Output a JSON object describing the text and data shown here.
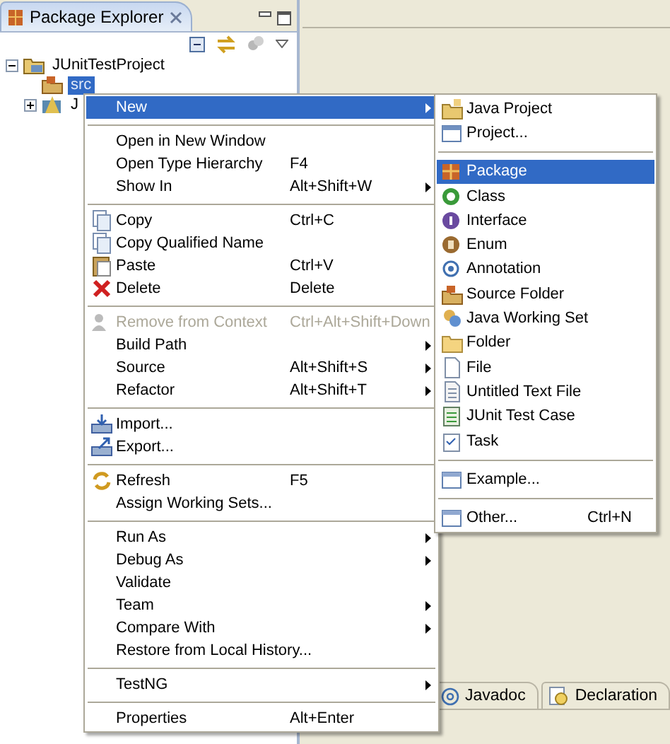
{
  "view": {
    "title": "Package Explorer"
  },
  "tree": [
    {
      "label": "JUnitTestProject",
      "expanded": true,
      "selected": false,
      "children": [
        {
          "label": "src",
          "selected": false,
          "highlighted": true
        },
        {
          "label": "J",
          "expanded": false,
          "selected": false
        }
      ]
    }
  ],
  "context_menu": [
    {
      "kind": "item",
      "label": "New",
      "selected": true,
      "submenu": true
    },
    {
      "kind": "separator"
    },
    {
      "kind": "item",
      "label": "Open in New Window",
      "selected": false
    },
    {
      "kind": "item",
      "label": "Open Type Hierarchy",
      "shortcut": "F4",
      "selected": false
    },
    {
      "kind": "item",
      "label": "Show In",
      "shortcut": "Alt+Shift+W",
      "selected": false,
      "submenu": true
    },
    {
      "kind": "separator"
    },
    {
      "kind": "item",
      "label": "Copy",
      "shortcut": "Ctrl+C",
      "selected": false
    },
    {
      "kind": "item",
      "label": "Copy Qualified Name",
      "selected": false
    },
    {
      "kind": "item",
      "label": "Paste",
      "shortcut": "Ctrl+V",
      "selected": false
    },
    {
      "kind": "item",
      "label": "Delete",
      "shortcut": "Delete",
      "selected": false
    },
    {
      "kind": "separator"
    },
    {
      "kind": "item",
      "label": "Remove from Context",
      "shortcut": "Ctrl+Alt+Shift+Down",
      "selected": false,
      "disabled": true
    },
    {
      "kind": "item",
      "label": "Build Path",
      "selected": false,
      "submenu": true
    },
    {
      "kind": "item",
      "label": "Source",
      "shortcut": "Alt+Shift+S",
      "selected": false,
      "submenu": true
    },
    {
      "kind": "item",
      "label": "Refactor",
      "shortcut": "Alt+Shift+T",
      "selected": false,
      "submenu": true
    },
    {
      "kind": "separator"
    },
    {
      "kind": "item",
      "label": "Import...",
      "selected": false
    },
    {
      "kind": "item",
      "label": "Export...",
      "selected": false
    },
    {
      "kind": "separator"
    },
    {
      "kind": "item",
      "label": "Refresh",
      "shortcut": "F5",
      "selected": false
    },
    {
      "kind": "item",
      "label": "Assign Working Sets...",
      "selected": false
    },
    {
      "kind": "separator"
    },
    {
      "kind": "item",
      "label": "Run As",
      "selected": false,
      "submenu": true
    },
    {
      "kind": "item",
      "label": "Debug As",
      "selected": false,
      "submenu": true
    },
    {
      "kind": "item",
      "label": "Validate",
      "selected": false
    },
    {
      "kind": "item",
      "label": "Team",
      "selected": false,
      "submenu": true
    },
    {
      "kind": "item",
      "label": "Compare With",
      "selected": false,
      "submenu": true
    },
    {
      "kind": "item",
      "label": "Restore from Local History...",
      "selected": false
    },
    {
      "kind": "separator"
    },
    {
      "kind": "item",
      "label": "TestNG",
      "selected": false,
      "submenu": true
    },
    {
      "kind": "separator"
    },
    {
      "kind": "item",
      "label": "Properties",
      "shortcut": "Alt+Enter",
      "selected": false
    }
  ],
  "new_submenu": [
    {
      "kind": "item",
      "label": "Java Project",
      "selected": false
    },
    {
      "kind": "item",
      "label": "Project...",
      "selected": false
    },
    {
      "kind": "separator"
    },
    {
      "kind": "item",
      "label": "Package",
      "selected": true
    },
    {
      "kind": "item",
      "label": "Class",
      "selected": false
    },
    {
      "kind": "item",
      "label": "Interface",
      "selected": false
    },
    {
      "kind": "item",
      "label": "Enum",
      "selected": false
    },
    {
      "kind": "item",
      "label": "Annotation",
      "selected": false
    },
    {
      "kind": "item",
      "label": "Source Folder",
      "selected": false
    },
    {
      "kind": "item",
      "label": "Java Working Set",
      "selected": false
    },
    {
      "kind": "item",
      "label": "Folder",
      "selected": false
    },
    {
      "kind": "item",
      "label": "File",
      "selected": false
    },
    {
      "kind": "item",
      "label": "Untitled Text File",
      "selected": false
    },
    {
      "kind": "item",
      "label": "JUnit Test Case",
      "selected": false
    },
    {
      "kind": "item",
      "label": "Task",
      "selected": false
    },
    {
      "kind": "separator"
    },
    {
      "kind": "item",
      "label": "Example...",
      "selected": false
    },
    {
      "kind": "separator"
    },
    {
      "kind": "item",
      "label": "Other...",
      "shortcut": "Ctrl+N",
      "selected": false
    }
  ],
  "bottom_tabs": [
    {
      "label": "Javadoc",
      "selected": false
    },
    {
      "label": "Declaration",
      "selected": false
    }
  ]
}
